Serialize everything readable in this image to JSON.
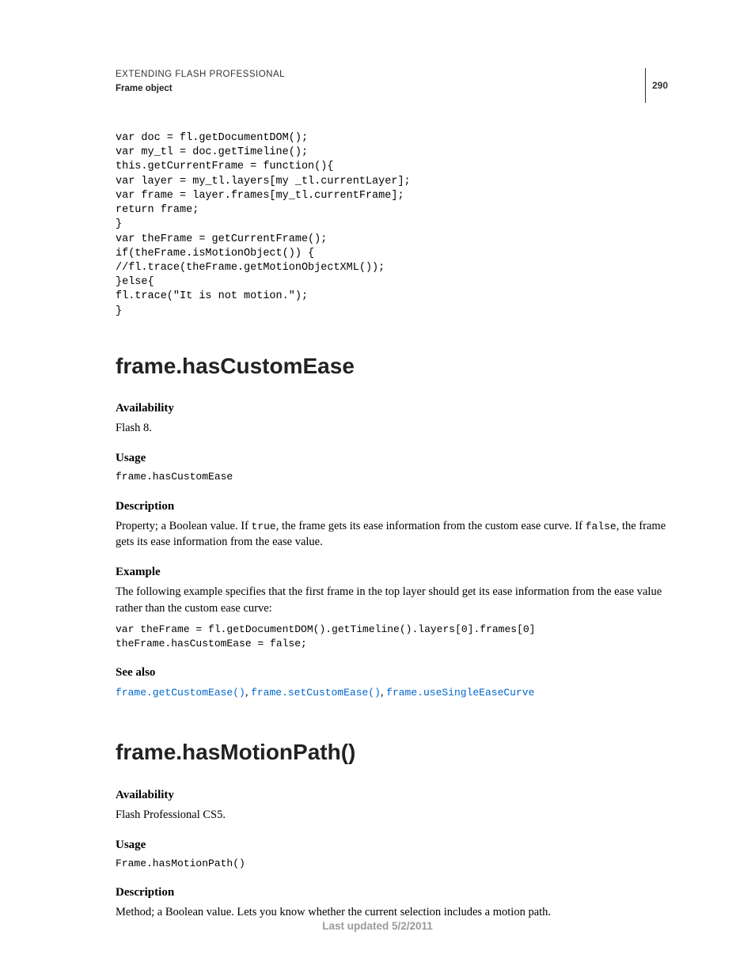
{
  "header": {
    "title": "EXTENDING FLASH PROFESSIONAL",
    "subtitle": "Frame object",
    "page_number": "290"
  },
  "code_top": "var doc = fl.getDocumentDOM();\nvar my_tl = doc.getTimeline();\nthis.getCurrentFrame = function(){\nvar layer = my_tl.layers[my _tl.currentLayer];\nvar frame = layer.frames[my_tl.currentFrame];\nreturn frame;\n}\nvar theFrame = getCurrentFrame();\nif(theFrame.isMotionObject()) {\n//fl.trace(theFrame.getMotionObjectXML());\n}else{\nfl.trace(\"It is not motion.\");\n}",
  "section1": {
    "title": "frame.hasCustomEase",
    "availability_h": "Availability",
    "availability": "Flash 8.",
    "usage_h": "Usage",
    "usage_code": "frame.hasCustomEase",
    "description_h": "Description",
    "description_pre": "Property; a Boolean value. If ",
    "description_code1": "true",
    "description_mid": ", the frame gets its ease information from the custom ease curve. If ",
    "description_code2": "false",
    "description_post": ", the frame gets its ease information from the ease value.",
    "example_h": "Example",
    "example_text": "The following example specifies that the first frame in the top layer should get its ease information from the ease value rather than the custom ease curve:",
    "example_code": "var theFrame = fl.getDocumentDOM().getTimeline().layers[0].frames[0]\ntheFrame.hasCustomEase = false;",
    "see_also_h": "See also",
    "see_also_sep": ", ",
    "links": {
      "l1": "frame.getCustomEase()",
      "l2": "frame.setCustomEase()",
      "l3": "frame.useSingleEaseCurve"
    }
  },
  "section2": {
    "title": "frame.hasMotionPath()",
    "availability_h": "Availability",
    "availability": "Flash Professional CS5.",
    "usage_h": "Usage",
    "usage_code": "Frame.hasMotionPath()",
    "description_h": "Description",
    "description": "Method; a Boolean value. Lets you know whether the current selection includes a motion path."
  },
  "footer": "Last updated 5/2/2011"
}
